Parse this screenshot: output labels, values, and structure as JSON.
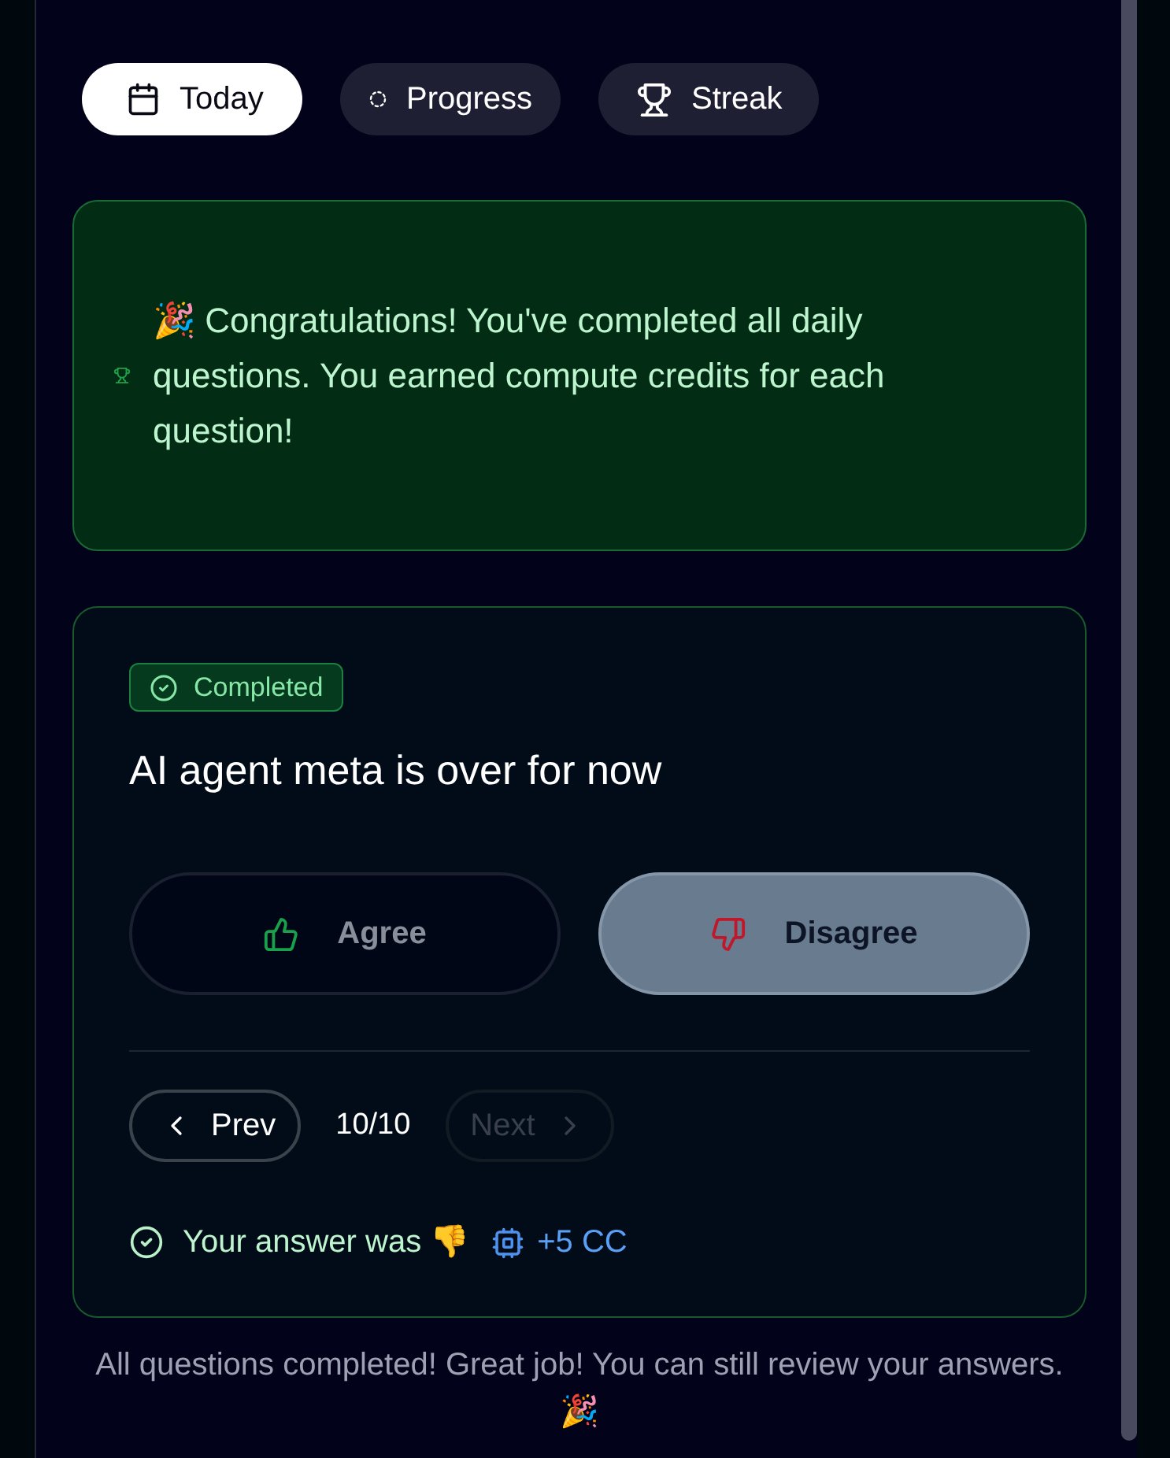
{
  "tabs": [
    {
      "label": "Today",
      "selected": true
    },
    {
      "label": "Progress",
      "selected": false
    },
    {
      "label": "Streak",
      "selected": false
    }
  ],
  "banner": {
    "text": "🎉 Congratulations! You've completed all daily questions. You earned compute credits for each question!"
  },
  "question_card": {
    "status_badge": "Completed",
    "question": "AI agent meta is over for now",
    "answers": [
      {
        "kind": "agree",
        "label": "Agree",
        "selected": false
      },
      {
        "kind": "disagree",
        "label": "Disagree",
        "selected": true
      }
    ],
    "pager": {
      "prev": {
        "label": "Prev",
        "disabled": false
      },
      "counter": "10/10",
      "next": {
        "label": "Next",
        "disabled": true
      }
    },
    "result": {
      "text": "Your answer was 👎",
      "reward": "+5 CC"
    }
  },
  "footer_note": "All questions completed! Great job! You can still review your answers. 🎉"
}
